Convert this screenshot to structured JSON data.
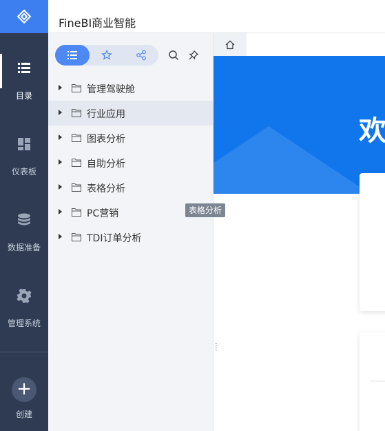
{
  "app": {
    "title": "FineBI商业智能"
  },
  "nav": {
    "items": [
      {
        "label": "目录",
        "icon": "list-icon"
      },
      {
        "label": "仪表板",
        "icon": "dashboard-icon"
      },
      {
        "label": "数据准备",
        "icon": "database-icon"
      },
      {
        "label": "管理系统",
        "icon": "gear-icon"
      }
    ],
    "create_label": "创建",
    "create_icon": "+"
  },
  "dir": {
    "tabs": [
      {
        "name": "list-icon"
      },
      {
        "name": "star-icon"
      },
      {
        "name": "share-icon"
      }
    ],
    "tools": [
      {
        "name": "search-icon"
      },
      {
        "name": "pin-icon"
      }
    ],
    "items": [
      "管理驾驶舱",
      "行业应用",
      "图表分析",
      "自助分析",
      "表格分析",
      "PC营销",
      "TDI订单分析"
    ],
    "tooltip": "表格分析"
  },
  "content": {
    "welcome": "欢"
  },
  "colors": {
    "nav_bg": "#2e3b53",
    "accent": "#3d7ff0",
    "banner": "#1176ec"
  }
}
